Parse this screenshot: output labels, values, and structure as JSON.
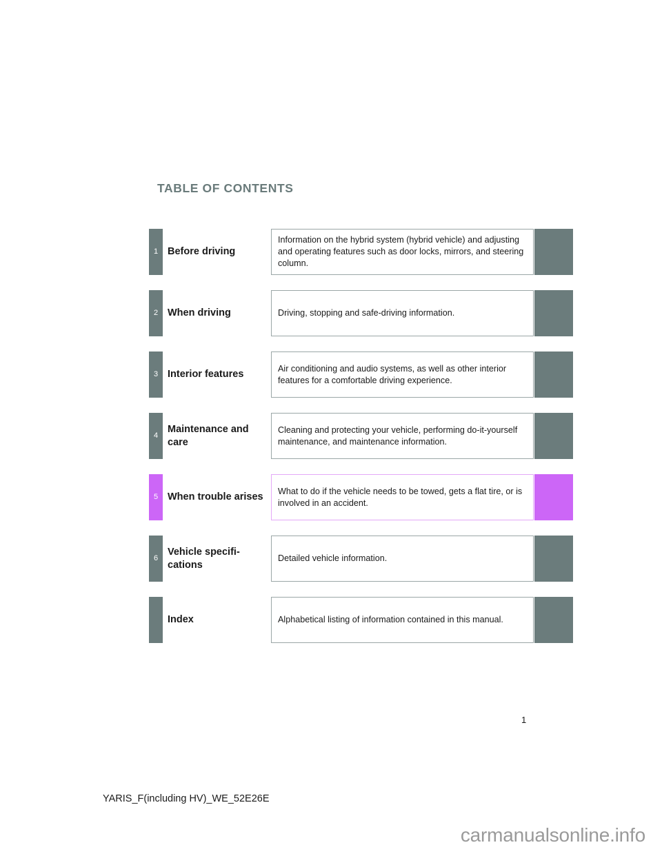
{
  "document": {
    "heading": "TABLE OF CONTENTS",
    "page_number": "1",
    "footer_code": "YARIS_F(including HV)_WE_52E26E",
    "watermark": "carmanualsonline.info"
  },
  "colors": {
    "tab_default": "#6b7c7c",
    "tab_accent": "#cc66f7",
    "heading": "#6a7b7b",
    "box_border": "#9aa6a6",
    "box_border_accent": "#e3a8f8",
    "text": "#1a1a1a",
    "watermark": "#9a9a9a"
  },
  "contents": {
    "rows": [
      {
        "number": "1",
        "title": "Before driving",
        "description": "Information on the hybrid system (hybrid vehicle) and adjusting and operating features such as door locks, mirrors, and steering column.",
        "highlighted": false
      },
      {
        "number": "2",
        "title": "When driving",
        "description": "Driving, stopping and safe-driving information.",
        "highlighted": false
      },
      {
        "number": "3",
        "title": "Interior features",
        "description": "Air conditioning and audio systems, as well as other interior features for a comfortable driving experience.",
        "highlighted": false
      },
      {
        "number": "4",
        "title": "Maintenance and care",
        "description": "Cleaning and protecting your vehicle, performing do-it-yourself maintenance, and maintenance information.",
        "highlighted": false
      },
      {
        "number": "5",
        "title": "When trouble arises",
        "description": "What to do if the vehicle needs to be towed, gets a flat tire, or is involved in an accident.",
        "highlighted": true
      },
      {
        "number": "6",
        "title": "Vehicle specifi-cations",
        "description": "Detailed vehicle information.",
        "highlighted": false
      },
      {
        "number": "",
        "title": "Index",
        "description": "Alphabetical listing of information contained in this manual.",
        "highlighted": false
      }
    ]
  }
}
